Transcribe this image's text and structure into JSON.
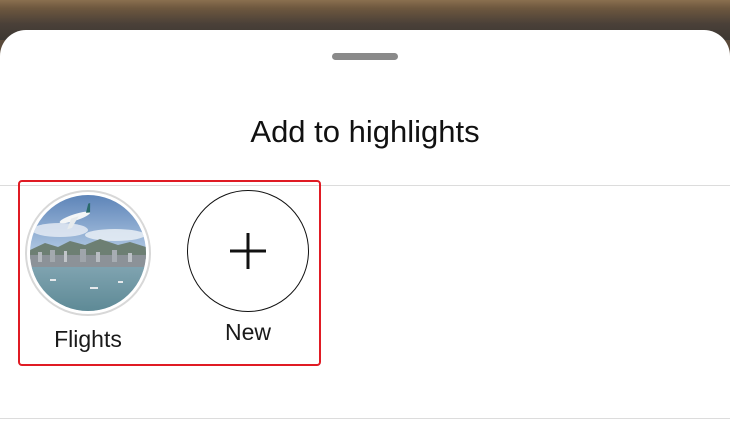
{
  "sheet": {
    "title": "Add to highlights"
  },
  "highlights": [
    {
      "label": "Flights",
      "icon": "flights-thumbnail"
    },
    {
      "label": "New",
      "icon": "plus-icon"
    }
  ],
  "colors": {
    "selection_outline": "#e01b24",
    "sheet_background": "#ffffff"
  }
}
